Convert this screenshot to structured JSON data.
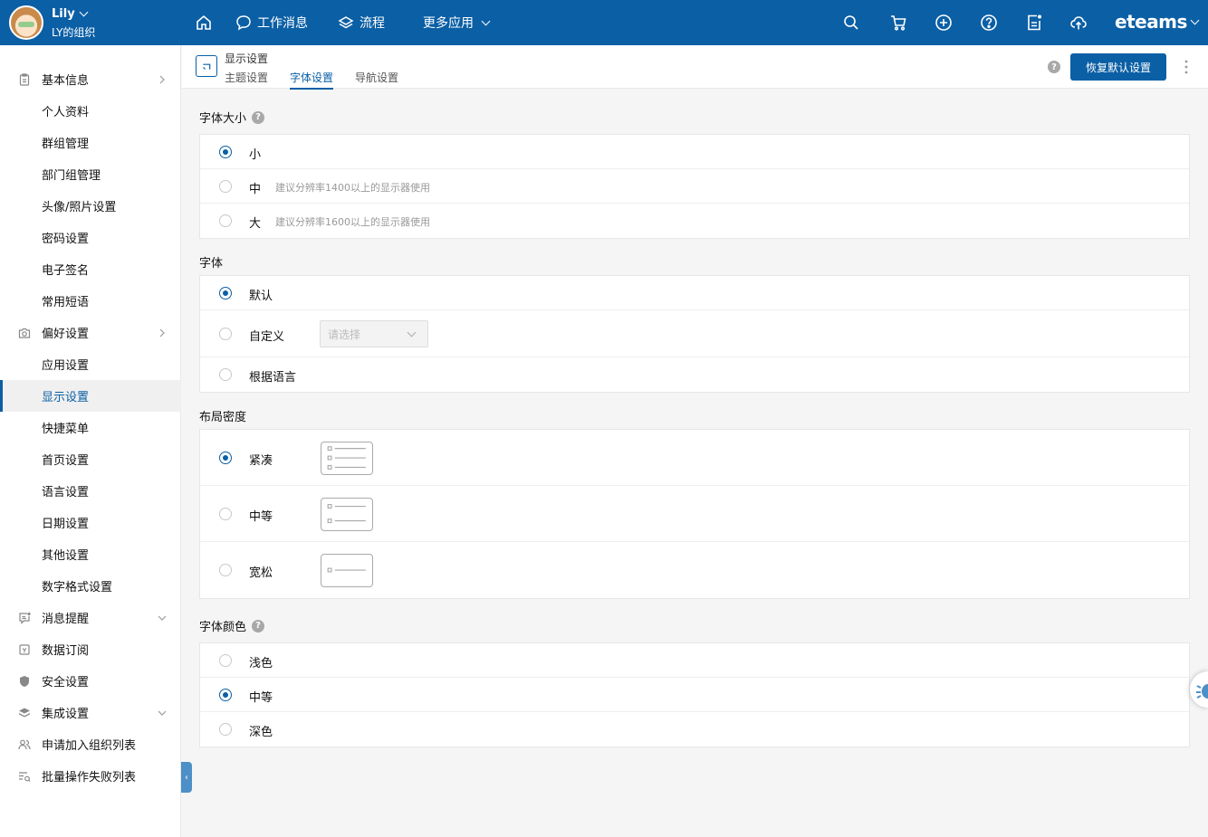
{
  "topbar": {
    "user_name": "Lily",
    "org_name": "LY的组织",
    "nav": {
      "home": "home-icon",
      "messages": "工作消息",
      "workflow": "流程",
      "more_apps": "更多应用"
    },
    "brand": "eteams"
  },
  "sidebar": {
    "items": [
      {
        "label": "基本信息"
      },
      {
        "label": "个人资料"
      },
      {
        "label": "群组管理"
      },
      {
        "label": "部门组管理"
      },
      {
        "label": "头像/照片设置"
      },
      {
        "label": "密码设置"
      },
      {
        "label": "电子签名"
      },
      {
        "label": "常用短语"
      },
      {
        "label": "偏好设置"
      },
      {
        "label": "应用设置"
      },
      {
        "label": "显示设置"
      },
      {
        "label": "快捷菜单"
      },
      {
        "label": "首页设置"
      },
      {
        "label": "语言设置"
      },
      {
        "label": "日期设置"
      },
      {
        "label": "其他设置"
      },
      {
        "label": "数字格式设置"
      },
      {
        "label": "消息提醒"
      },
      {
        "label": "数据订阅"
      },
      {
        "label": "安全设置"
      },
      {
        "label": "集成设置"
      },
      {
        "label": "申请加入组织列表"
      },
      {
        "label": "批量操作失败列表"
      }
    ],
    "collapse_glyph": "‹"
  },
  "header": {
    "title": "显示设置",
    "tabs": [
      {
        "label": "主题设置"
      },
      {
        "label": "字体设置"
      },
      {
        "label": "导航设置"
      }
    ],
    "help_glyph": "?",
    "restore_button": "恢复默认设置"
  },
  "font_size": {
    "title": "字体大小",
    "help_glyph": "?",
    "options": [
      {
        "label": "小",
        "hint": ""
      },
      {
        "label": "中",
        "hint": "建议分辨率1400以上的显示器使用"
      },
      {
        "label": "大",
        "hint": "建议分辨率1600以上的显示器使用"
      }
    ],
    "selected": "小"
  },
  "font_family": {
    "title": "字体",
    "options": [
      {
        "label": "默认"
      },
      {
        "label": "自定义"
      },
      {
        "label": "根据语言"
      }
    ],
    "select_placeholder": "请选择",
    "selected": "默认"
  },
  "layout_density": {
    "title": "布局密度",
    "options": [
      {
        "label": "紧凑"
      },
      {
        "label": "中等"
      },
      {
        "label": "宽松"
      }
    ],
    "selected": "紧凑"
  },
  "font_color": {
    "title": "字体颜色",
    "help_glyph": "?",
    "options": [
      {
        "label": "浅色"
      },
      {
        "label": "中等"
      },
      {
        "label": "深色"
      }
    ],
    "selected": "中等"
  },
  "colors": {
    "accent": "#0b5fa5",
    "topbar_bg": "#0b5fa5"
  }
}
